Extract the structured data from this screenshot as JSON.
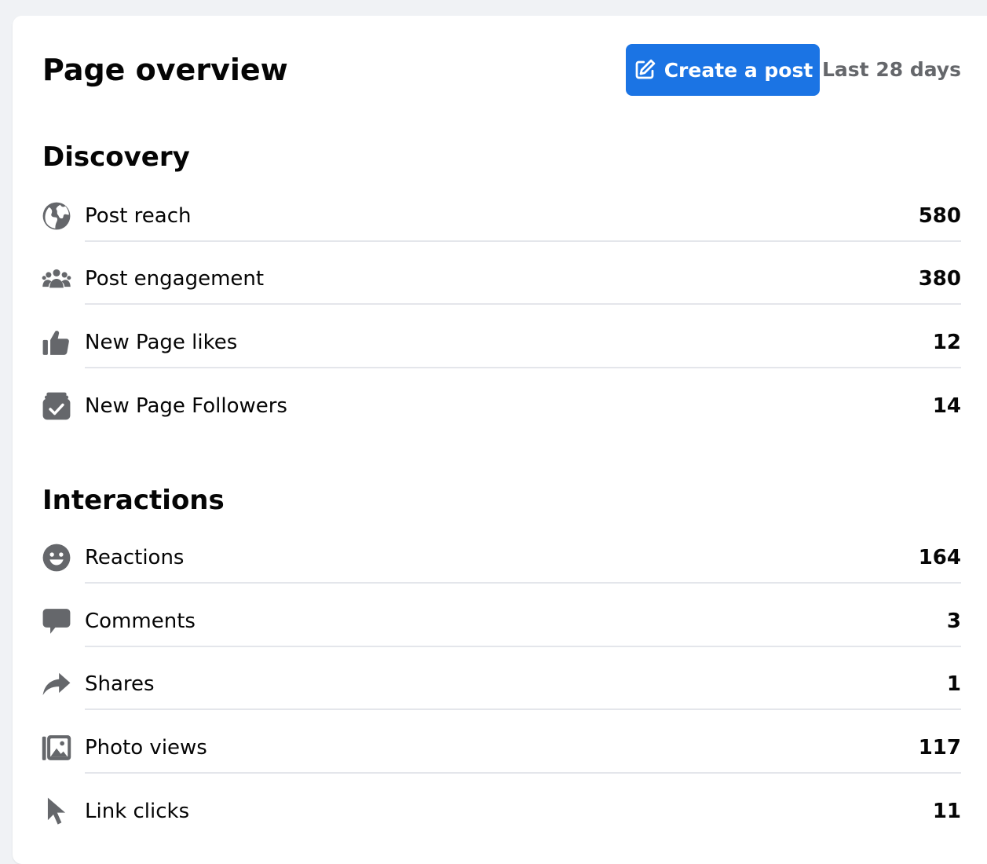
{
  "header": {
    "title": "Page overview",
    "create_label": "Create a post",
    "date_range": "Last 28 days",
    "accent_color": "#1b74e4"
  },
  "discovery": {
    "title": "Discovery",
    "items": [
      {
        "label": "Post reach",
        "value": "580",
        "icon": "globe-icon"
      },
      {
        "label": "Post engagement",
        "value": "380",
        "icon": "people-group-icon"
      },
      {
        "label": "New Page likes",
        "value": "12",
        "icon": "thumbs-up-icon"
      },
      {
        "label": "New Page Followers",
        "value": "14",
        "icon": "follow-check-icon"
      }
    ]
  },
  "interactions": {
    "title": "Interactions",
    "items": [
      {
        "label": "Reactions",
        "value": "164",
        "icon": "smiley-icon"
      },
      {
        "label": "Comments",
        "value": "3",
        "icon": "comment-bubble-icon"
      },
      {
        "label": "Shares",
        "value": "1",
        "icon": "share-arrow-icon"
      },
      {
        "label": "Photo views",
        "value": "117",
        "icon": "photo-stack-icon"
      },
      {
        "label": "Link clicks",
        "value": "11",
        "icon": "cursor-pointer-icon"
      }
    ]
  }
}
